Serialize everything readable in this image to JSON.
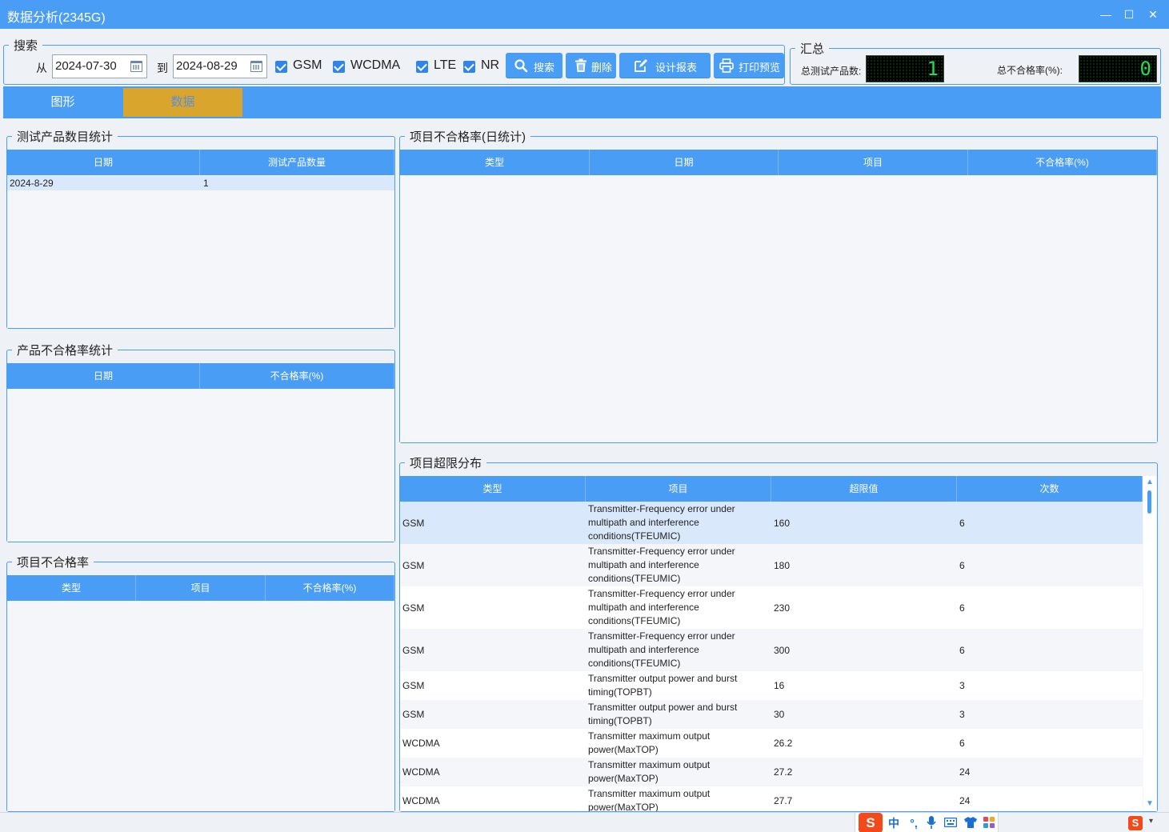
{
  "window": {
    "title": "数据分析(2345G)",
    "minimize_symbol": "—",
    "maximize_symbol": "☐",
    "close_symbol": "✕"
  },
  "search": {
    "legend": "搜索",
    "from_label": "从",
    "from_date": "2024-07-30",
    "to_label": "到",
    "to_date": "2024-08-29",
    "checkboxes": [
      {
        "label": "GSM",
        "checked": true
      },
      {
        "label": "WCDMA",
        "checked": true
      },
      {
        "label": "LTE",
        "checked": true
      },
      {
        "label": "NR",
        "checked": true
      }
    ],
    "buttons": {
      "search": "搜索",
      "delete": "删除",
      "design_report": "设计报表",
      "print_preview": "打印预览"
    }
  },
  "summary": {
    "legend": "汇总",
    "total_count_label": "总测试产品数:",
    "total_count_value": "1",
    "total_fail_rate_label": "总不合格率(%):",
    "total_fail_rate_value": "0"
  },
  "tabs": [
    {
      "label": "图形",
      "active": false
    },
    {
      "label": "数据",
      "active": true
    }
  ],
  "panels": {
    "product_count": {
      "legend": "测试产品数目统计",
      "columns": [
        "日期",
        "测试产品数量"
      ],
      "rows": [
        [
          "2024-8-29",
          "1"
        ]
      ]
    },
    "product_fail_rate": {
      "legend": "产品不合格率统计",
      "columns": [
        "日期",
        "不合格率(%)"
      ],
      "rows": []
    },
    "item_fail_rate": {
      "legend": "项目不合格率",
      "columns": [
        "类型",
        "项目",
        "不合格率(%)"
      ],
      "rows": []
    },
    "item_fail_rate_daily": {
      "legend": "项目不合格率(日统计)",
      "columns": [
        "类型",
        "日期",
        "项目",
        "不合格率(%)"
      ],
      "rows": []
    },
    "item_overlimit": {
      "legend": "项目超限分布",
      "columns": [
        "类型",
        "项目",
        "超限值",
        "次数"
      ],
      "rows": [
        [
          "GSM",
          "Transmitter-Frequency error under multipath and interference conditions(TFEUMIC)",
          "160",
          "6"
        ],
        [
          "GSM",
          "Transmitter-Frequency error under multipath and interference conditions(TFEUMIC)",
          "180",
          "6"
        ],
        [
          "GSM",
          "Transmitter-Frequency error under multipath and interference conditions(TFEUMIC)",
          "230",
          "6"
        ],
        [
          "GSM",
          "Transmitter-Frequency error under multipath and interference conditions(TFEUMIC)",
          "300",
          "6"
        ],
        [
          "GSM",
          "Transmitter output power and burst timing(TOPBT)",
          "16",
          "3"
        ],
        [
          "GSM",
          "Transmitter output power and burst timing(TOPBT)",
          "30",
          "3"
        ],
        [
          "WCDMA",
          "Transmitter maximum output power(MaxTOP)",
          "26.2",
          "6"
        ],
        [
          "WCDMA",
          "Transmitter maximum output power(MaxTOP)",
          "27.2",
          "24"
        ],
        [
          "WCDMA",
          "Transmitter maximum output power(MaxTOP)",
          "27.7",
          "24"
        ]
      ]
    }
  },
  "ime_toolbar": {
    "logo": "S",
    "lang": "中",
    "punct": "°,",
    "items": [
      "microphone-icon",
      "keyboard-icon",
      "shirt-icon",
      "apps-icon"
    ]
  },
  "colors": {
    "accent": "#4a9df5",
    "active_tab": "#d9a52c",
    "led_text": "#2bd659",
    "selected_row": "#d9e9fb"
  }
}
